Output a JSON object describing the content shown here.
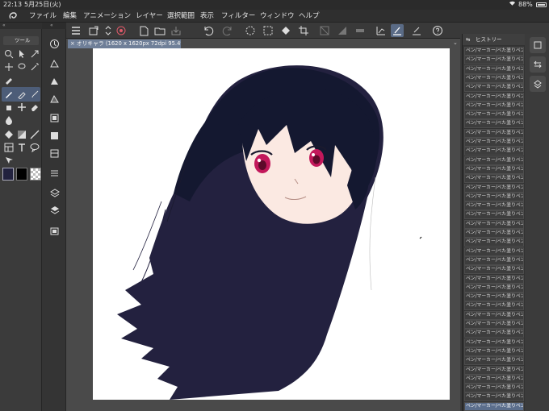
{
  "status": {
    "time": "22:13",
    "date": "5月25日(火)",
    "battery": "88%"
  },
  "menu": [
    "ファイル",
    "編集",
    "アニメーション",
    "レイヤー",
    "選択範囲",
    "表示",
    "フィルター",
    "ウィンドウ",
    "ヘルプ"
  ],
  "tool_panel": {
    "title": "ツール"
  },
  "document": {
    "tab_label": "オリキャラ (1620 x 1620px 72dpi 95.4%)"
  },
  "history": {
    "title": "ヒストリー",
    "entry_label": "ペン/マーカー/べた塗りペン",
    "entries": [
      "ペン/マーカー/べた塗りペン",
      "ペン/マーカー/べた塗りペン",
      "ペン/マーカー/べた塗りペン",
      "ペン/マーカー/べた塗りペン",
      "ペン/マーカー/べた塗りペン",
      "ペン/マーカー/べた塗りペン",
      "ペン/マーカー/べた塗りペン",
      "ペン/マーカー/べた塗りペン",
      "ペン/マーカー/べた塗りペン",
      "ペン/マーカー/べた塗りペン",
      "ペン/マーカー/べた塗りペン",
      "ペン/マーカー/べた塗りペン",
      "ペン/マーカー/べた塗りペン",
      "ペン/マーカー/べた塗りペン",
      "ペン/マーカー/べた塗りペン",
      "ペン/マーカー/べた塗りペン",
      "ペン/マーカー/べた塗りペン",
      "ペン/マーカー/べた塗りペン",
      "ペン/マーカー/べた塗りペン",
      "ペン/マーカー/べた塗りペン",
      "ペン/マーカー/べた塗りペン",
      "ペン/マーカー/べた塗りペン",
      "ペン/マーカー/べた塗りペン",
      "ペン/マーカー/べた塗りペン",
      "ペン/マーカー/べた塗りペン",
      "ペン/マーカー/べた塗りペン",
      "ペン/マーカー/べた塗りペン",
      "ペン/マーカー/べた塗りペン",
      "ペン/マーカー/べた塗りペン",
      "ペン/マーカー/べた塗りペン",
      "ペン/マーカー/べた塗りペン",
      "ペン/マーカー/べた塗りペン",
      "ペン/マーカー/べた塗りペン",
      "ペン/マーカー/べた塗りペン",
      "ペン/マーカー/べた塗りペン",
      "ペン/マーカー/べた塗りペン",
      "ペン/マーカー/べた塗りペン",
      "ペン/マーカー/べた塗りペン",
      "ペン/マーカー/べた塗りペン",
      "ペン/マーカー/べた塗りペン"
    ]
  },
  "colors": {
    "main": "#22223e",
    "sub": "#000000",
    "accent": "#5b6e8c",
    "hair": "#1b1d35",
    "skin": "#fbe9e2",
    "eye": "#c2185b"
  },
  "icons": {
    "toolbar": [
      "menu-icon",
      "transform-icon",
      "chevrons-icon",
      "undo-record-icon",
      "new-canvas-icon",
      "open-icon",
      "save-icon",
      "undo-icon",
      "redo-icon",
      "lasso-fill-icon",
      "selection-icon",
      "fill-icon",
      "crop-icon",
      "transparency-icon",
      "gradient-icon",
      "ruler-icon",
      "stabilizer-icon",
      "pen-pressure-icon",
      "correction-icon",
      "help-icon"
    ],
    "tools": [
      "zoom-icon",
      "move-icon",
      "eyedropper-icon",
      "pen-icon",
      "eraser-icon",
      "fill-icon",
      "text-icon",
      "balloon-icon",
      "figure-icon"
    ]
  }
}
